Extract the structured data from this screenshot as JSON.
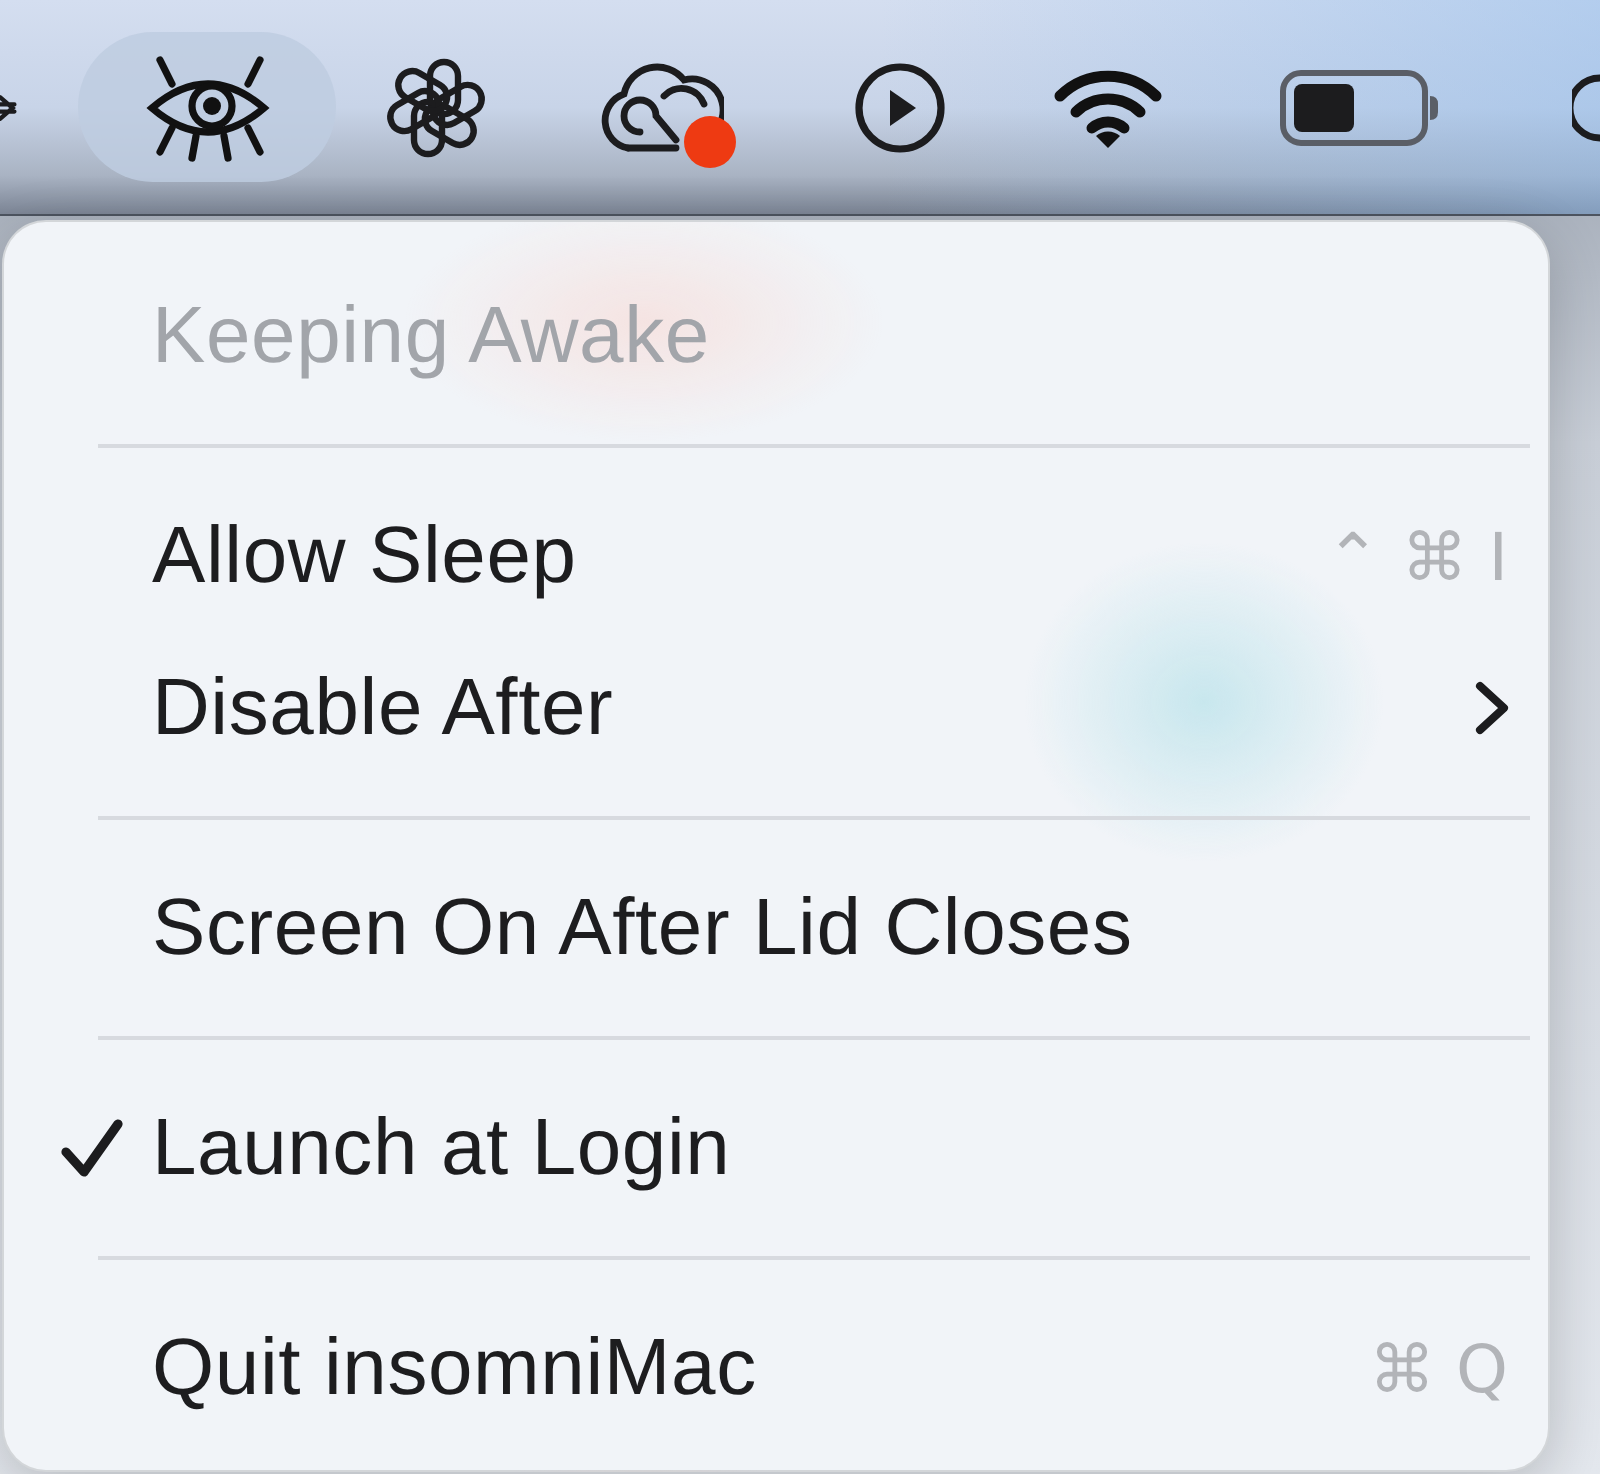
{
  "menu_bar": {
    "items": [
      {
        "selected": false,
        "badge": false
      },
      {
        "selected": true,
        "badge": false
      },
      {
        "selected": false,
        "badge": false
      },
      {
        "selected": false,
        "badge": true
      },
      {
        "selected": false,
        "badge": false
      },
      {
        "selected": false,
        "badge": false
      },
      {
        "selected": false,
        "badge": false
      },
      {
        "selected": false,
        "badge": false
      }
    ]
  },
  "menu": {
    "items": [
      {
        "kind": "header",
        "label": "Keeping Awake"
      },
      {
        "kind": "separator"
      },
      {
        "kind": "item",
        "label": "Allow Sleep",
        "shortcut": "⌃ ⌘ I",
        "checked": false,
        "submenu": false
      },
      {
        "kind": "item",
        "label": "Disable After",
        "checked": false,
        "submenu": true
      },
      {
        "kind": "separator"
      },
      {
        "kind": "item",
        "label": "Screen On After Lid Closes",
        "checked": false,
        "submenu": false
      },
      {
        "kind": "separator"
      },
      {
        "kind": "item",
        "label": "Launch at Login",
        "checked": true,
        "submenu": false
      },
      {
        "kind": "separator"
      },
      {
        "kind": "item",
        "label": "Quit insomniMac",
        "shortcut": "⌘ Q",
        "checked": false,
        "submenu": false
      }
    ]
  }
}
